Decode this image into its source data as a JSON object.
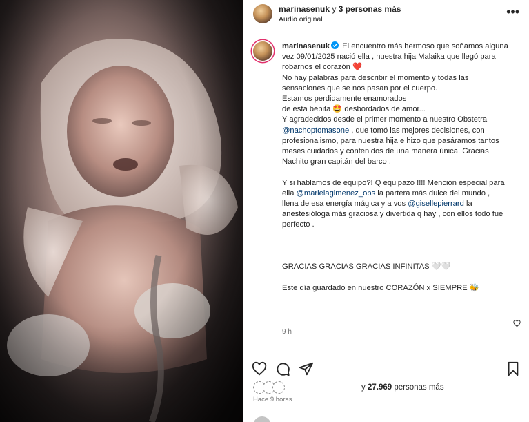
{
  "header": {
    "username": "marinasenuk",
    "connector": " y ",
    "others": "3 personas más",
    "audio": "Audio original",
    "more_icon": "more-dots-icon"
  },
  "caption": {
    "username": "marinasenuk",
    "lines": [
      "El encuentro más hermoso que soñamos alguna",
      "vez 09/01/2025 nació ella , nuestra hija Malaika que llegó para",
      "robarnos el corazón ❤️",
      "No hay palabras para describir el momento y todas las",
      "sensaciones que se nos pasan por el cuerpo.",
      "Estamos perdidamente enamorados",
      "de esta bebita 🤩 desbordados de amor...",
      "Y agradecidos desde el primer momento a nuestro Obstetra",
      "",
      "profesionalismo, para nuestra hija e hizo que pasáramos tantos",
      "meses cuidados y contenidos de una manera única. Gracias",
      "Nachito gran capitán del barco ."
    ],
    "mention1": "@nachoptomasone",
    "mention1_after": " , que tomó las mejores decisiones, con",
    "paragraph2_line1": "Y si hablamos de equipo?! Q equipazo !!!! Mención especial para",
    "p2_ella": "ella ",
    "mention2": "@marielagimenez_obs",
    "p2_after_mention2": " la partera más dulce del mundo ,",
    "p2_line3_before": "llena de esa energía mágica y a vos ",
    "mention3": "@giselle​pierrard",
    "p2_line3_after": " la",
    "p2_line4": "anestesióloga más graciosa y divertida q hay , con ellos todo fue",
    "p2_line5": "perfecto .",
    "gracias": "GRACIAS GRACIAS GRACIAS INFINITAS 🤍🤍",
    "final": "Este día guardado en nuestro CORAZÓN x SIEMPRE 🐝",
    "time": "9 h"
  },
  "actions": {
    "like_icon": "heart-icon",
    "comment_icon": "comment-icon",
    "share_icon": "share-icon",
    "save_icon": "bookmark-icon"
  },
  "likes": {
    "prefix": "y ",
    "count": "27.969",
    "suffix": " personas más"
  },
  "posted": "Hace 9 horas",
  "colors": {
    "accent_red": "#ed4956",
    "mention_blue": "#00376b",
    "verified_blue": "#0095f6"
  }
}
